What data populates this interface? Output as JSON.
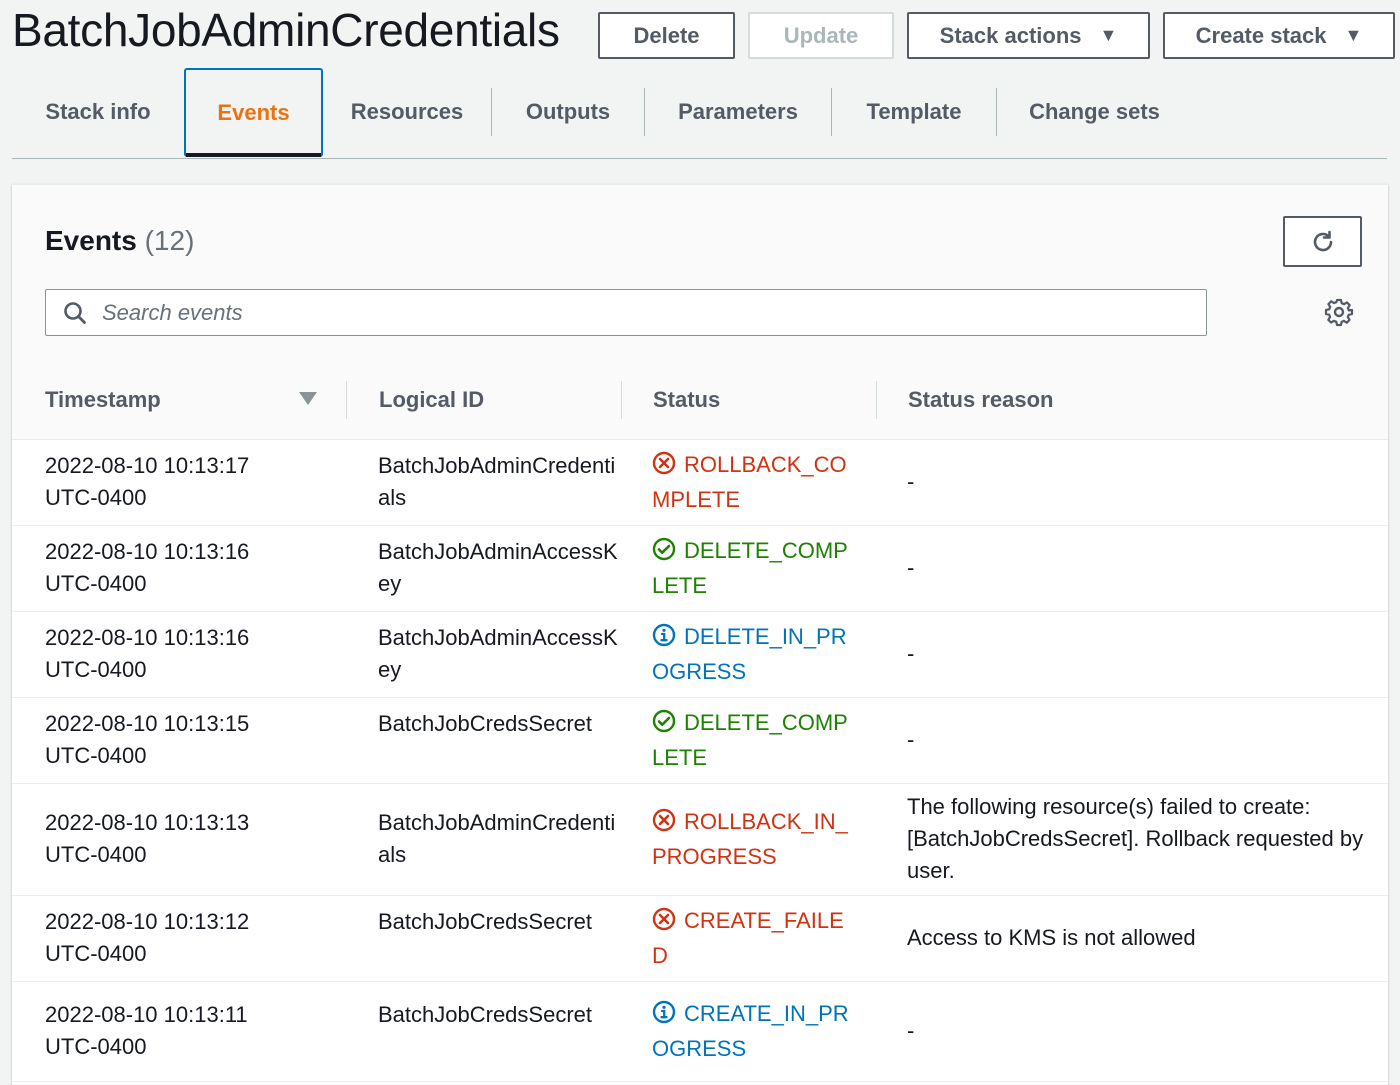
{
  "header": {
    "title": "BatchJobAdminCredentials",
    "buttons": {
      "delete": "Delete",
      "update": "Update",
      "stack_actions": "Stack actions",
      "create_stack": "Create stack"
    }
  },
  "tabs": [
    "Stack info",
    "Events",
    "Resources",
    "Outputs",
    "Parameters",
    "Template",
    "Change sets"
  ],
  "active_tab": "Events",
  "events_panel": {
    "title": "Events",
    "count": "(12)",
    "search_placeholder": "Search events",
    "columns": [
      "Timestamp",
      "Logical ID",
      "Status",
      "Status reason"
    ],
    "rows": [
      {
        "timestamp": [
          "2022-08-10 10:13:17",
          "UTC-0400"
        ],
        "logical_id": "BatchJobAdminCredentials",
        "status": "ROLLBACK_COMPLETE",
        "status_type": "error",
        "reason": "-"
      },
      {
        "timestamp": [
          "2022-08-10 10:13:16",
          "UTC-0400"
        ],
        "logical_id": "BatchJobAdminAccessKey",
        "status": "DELETE_COMPLETE",
        "status_type": "success",
        "reason": "-"
      },
      {
        "timestamp": [
          "2022-08-10 10:13:16",
          "UTC-0400"
        ],
        "logical_id": "BatchJobAdminAccessKey",
        "status": "DELETE_IN_PROGRESS",
        "status_type": "info",
        "reason": "-"
      },
      {
        "timestamp": [
          "2022-08-10 10:13:15",
          "UTC-0400"
        ],
        "logical_id": "BatchJobCredsSecret",
        "status": "DELETE_COMPLETE",
        "status_type": "success",
        "reason": "-"
      },
      {
        "timestamp": [
          "2022-08-10 10:13:13",
          "UTC-0400"
        ],
        "logical_id": "BatchJobAdminCredentials",
        "status": "ROLLBACK_IN_PROGRESS",
        "status_type": "error",
        "reason": "The following resource(s) failed to create: [BatchJobCredsSecret]. Rollback requested by user."
      },
      {
        "timestamp": [
          "2022-08-10 10:13:12",
          "UTC-0400"
        ],
        "logical_id": "BatchJobCredsSecret",
        "status": "CREATE_FAILED",
        "status_type": "error",
        "reason": "Access to KMS is not allowed"
      },
      {
        "timestamp": [
          "2022-08-10 10:13:11",
          "UTC-0400"
        ],
        "logical_id": "BatchJobCredsSecret",
        "status": "CREATE_IN_PROGRESS",
        "status_type": "info",
        "reason": "-"
      }
    ]
  },
  "colors": {
    "accent": "#ec7211",
    "error": "#d13212",
    "success": "#1d8102",
    "info": "#0073bb"
  },
  "icons": {
    "error": "x-circle-icon",
    "success": "check-circle-icon",
    "info": "info-circle-icon",
    "refresh": "refresh-icon",
    "search": "search-icon",
    "settings": "gear-icon"
  }
}
